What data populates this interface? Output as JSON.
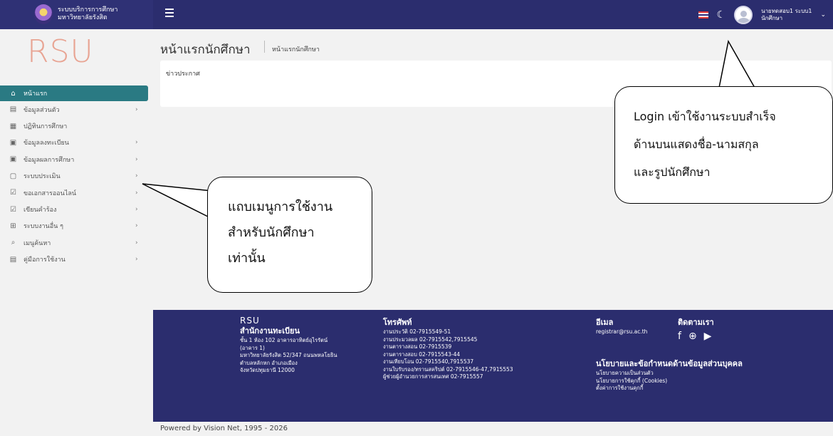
{
  "header": {
    "brand_line1": "ระบบบริการการศึกษา",
    "brand_line2": "มหาวิทยาลัยรังสิต",
    "user_name": "นายทดสอบ1 ระบบ1",
    "user_role": "นักศึกษา",
    "icons": [
      "menu-icon",
      "thai-flag-icon",
      "moon-icon",
      "avatar",
      "chevron-down-icon"
    ]
  },
  "sidebar": {
    "logo_text": "RSU",
    "items": [
      {
        "label": "หน้าแรก",
        "icon": "⌂",
        "active": true,
        "arrow": ""
      },
      {
        "label": "ข้อมูลส่วนตัว",
        "icon": "▤",
        "arrow": "›"
      },
      {
        "label": "ปฏิทินการศึกษา",
        "icon": "▦",
        "arrow": ""
      },
      {
        "label": "ข้อมูลลงทะเบียน",
        "icon": "▣",
        "arrow": "›"
      },
      {
        "label": "ข้อมูลผลการศึกษา",
        "icon": "▣",
        "arrow": "›"
      },
      {
        "label": "ระบบประเมิน",
        "icon": "▢",
        "arrow": "›"
      },
      {
        "label": "ขอเอกสารออนไลน์",
        "icon": "☑",
        "arrow": "›"
      },
      {
        "label": "เขียนคำร้อง",
        "icon": "☑",
        "arrow": "›"
      },
      {
        "label": "ระบบงานอื่น ๆ",
        "icon": "⊞",
        "arrow": "›"
      },
      {
        "label": "เมนูค้นหา",
        "icon": "⌕",
        "arrow": "›"
      },
      {
        "label": "คู่มือการใช้งาน",
        "icon": "▤",
        "arrow": "›"
      }
    ]
  },
  "main": {
    "title": "หน้าแรกนักศึกษา",
    "breadcrumb": "หน้าแรกนักศึกษา",
    "card_title": "ข่าวประกาศ"
  },
  "footer": {
    "logo": "RSU",
    "office_title": "สำนักงานทะเบียน",
    "address": [
      "ชั้น 1 ห้อง 102 อาคารอาทิตย์อุไรรัตน์",
      "(อาคาร 1)",
      "มหาวิทยาลัยรังสิต 52/347 ถนนพหลโยธิน",
      "ตำบลหลักหก อำเภอเมือง",
      "จังหวัดปทุมธานี 12000"
    ],
    "phone_title": "โทรศัพท์",
    "phones": [
      "งานประวัติ 02-7915549-51",
      "งานประมวลผล 02-7915542,7915545",
      "งานตารางสอน 02-7915539",
      "งานตารางสอบ 02-7915543-44",
      "งานเทียบโอน 02-7915540,7915537",
      "งานใบรับรอง/ทรานสคริปต์ 02-7915546-47,7915553",
      "ผู้ช่วยผู้อำนวยการสารสนเทศ 02-7915557"
    ],
    "email_title": "อีเมล",
    "email": "registrar@rsu.ac.th",
    "follow_title": "ติดตามเรา",
    "policy_title": "นโยบายและข้อกำหนดด้านข้อมูลส่วนบุคคล",
    "policy_links": [
      "นโยบายความเป็นส่วนตัว",
      "นโยบายการใช้คุกกี้ (Cookies)",
      "ตั้งค่าการใช้งานคุกกี้"
    ],
    "social_icons": [
      "facebook-icon",
      "globe-icon",
      "youtube-icon"
    ]
  },
  "powered_by": "Powered by Vision Net, 1995 - 2026",
  "callouts": {
    "menu_note": [
      "แถบเมนูการใช้งาน",
      "สำหรับนักศึกษา",
      "เท่านั้น"
    ],
    "login_note": [
      "Login เข้าใช้งานระบบสำเร็จ",
      "ด้านบนแสดงชื่อ-นามสกุล",
      "และรูปนักศึกษา"
    ]
  },
  "colors": {
    "header_bg": "#2b2d6e",
    "active_menu": "#2a7a83",
    "logo": "#e8a493"
  }
}
